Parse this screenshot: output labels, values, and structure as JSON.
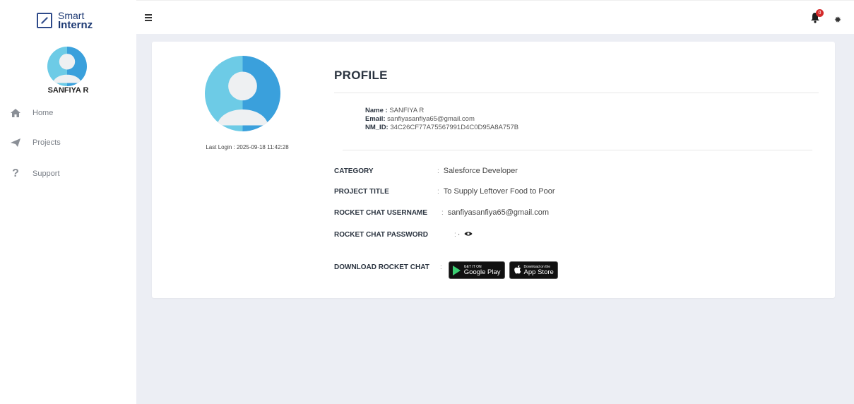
{
  "brand": {
    "line1": "Smart",
    "line2": "Internz"
  },
  "user": {
    "name": "SANFIYA R"
  },
  "sidebar": {
    "items": [
      {
        "label": "Home",
        "icon": "home-icon"
      },
      {
        "label": "Projects",
        "icon": "paper-plane-icon"
      },
      {
        "label": "Support",
        "icon": "question-icon"
      }
    ]
  },
  "topbar": {
    "notification_count": "0"
  },
  "profile": {
    "last_login": "Last Login : 2025-09-18 11:42:28",
    "title": "PROFILE",
    "name_label": "Name :",
    "name_value": "SANFIYA R",
    "email_label": "Email:",
    "email_value": "sanfiyasanfiya65@gmail.com",
    "nmid_label": "NM_ID:",
    "nmid_value": "34C26CF77A75567991D4C0D95A8A757B"
  },
  "details": {
    "category_label": "CATEGORY",
    "category_value": "Salesforce Developer",
    "project_label": "PROJECT TITLE",
    "project_value": "To Supply Leftover Food to Poor",
    "rc_user_label": "ROCKET CHAT USERNAME",
    "rc_user_value": "sanfiyasanfiya65@gmail.com",
    "rc_pass_label": "ROCKET CHAT PASSWORD",
    "rc_pass_value": "·",
    "download_label": "DOWNLOAD ROCKET CHAT",
    "separator": ":"
  },
  "stores": {
    "google_small": "GET IT ON",
    "google_large": "Google Play",
    "apple_small": "Download on the",
    "apple_large": "App Store"
  },
  "colors": {
    "accent": "#1e3a74",
    "badge": "#d42a2a",
    "avatar_light": "#6dcbe6",
    "avatar_dark": "#3aa0dc",
    "background": "#eceef4"
  }
}
